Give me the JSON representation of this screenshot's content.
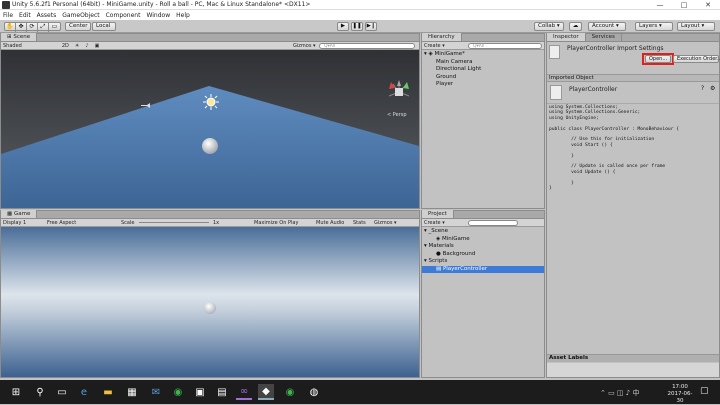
{
  "window": {
    "title": "Unity 5.6.2f1 Personal (64bit) - MiniGame.unity - Roll a ball - PC, Mac & Linux Standalone* <DX11>",
    "minimize": "—",
    "maximize": "□",
    "close": "✕"
  },
  "menu": [
    "File",
    "Edit",
    "Assets",
    "GameObject",
    "Component",
    "Window",
    "Help"
  ],
  "toolbar": {
    "center": "Center",
    "local": "Local",
    "play": "▶",
    "pause": "❚❚",
    "step": "▶❙",
    "collab": "Collab ▾",
    "account": "Account ▾",
    "layers": "Layers ▾",
    "layout": "Layout ▾"
  },
  "scene": {
    "tab": "Scene",
    "shaded": "Shaded",
    "mode2d": "2D",
    "gizmos": "Gizmos ▾",
    "search": "Q▾All",
    "persp": "< Persp"
  },
  "game": {
    "tab": "Game",
    "display": "Display 1",
    "aspect": "Free Aspect",
    "scale_label": "Scale",
    "scale_value": "1x",
    "maximize": "Maximize On Play",
    "mute": "Mute Audio",
    "stats": "Stats",
    "gizmos": "Gizmos ▾"
  },
  "hierarchy": {
    "tab": "Hierarchy",
    "create": "Create ▾",
    "search": "Q▾All",
    "scene": "MiniGame*",
    "items": [
      "Main Camera",
      "Directional Light",
      "Ground",
      "Player"
    ]
  },
  "project": {
    "tab": "Project",
    "create": "Create ▾",
    "items": [
      {
        "label": "▾ _Scene"
      },
      {
        "label": "MiniGame"
      },
      {
        "label": "▾ Materials"
      },
      {
        "label": "Background"
      },
      {
        "label": "▾ Scripts"
      },
      {
        "label": "PlayerController"
      }
    ]
  },
  "inspector": {
    "tab": "Inspector",
    "services_tab": "Services",
    "title": "PlayerController Import Settings",
    "open_button": "Open...",
    "exec_button": "Execution Order...",
    "imported_label": "Imported Object",
    "imported_name": "PlayerController",
    "code": "using System.Collections;\nusing System.Collections.Generic;\nusing UnityEngine;\n\npublic class PlayerController : MonoBehaviour {\n\n        // Use this for initialization\n        void Start () {\n\n        }\n\n        // Update is called once per frame\n        void Update () {\n\n        }\n}",
    "asset_labels": "Asset Labels"
  },
  "clock": {
    "time": "17:00",
    "date": "2017-06-30"
  },
  "colors": {
    "sky": "#3c3f43",
    "ground": "#4e78a8",
    "highlight": "#e0201c",
    "select": "#3d7bd6"
  }
}
